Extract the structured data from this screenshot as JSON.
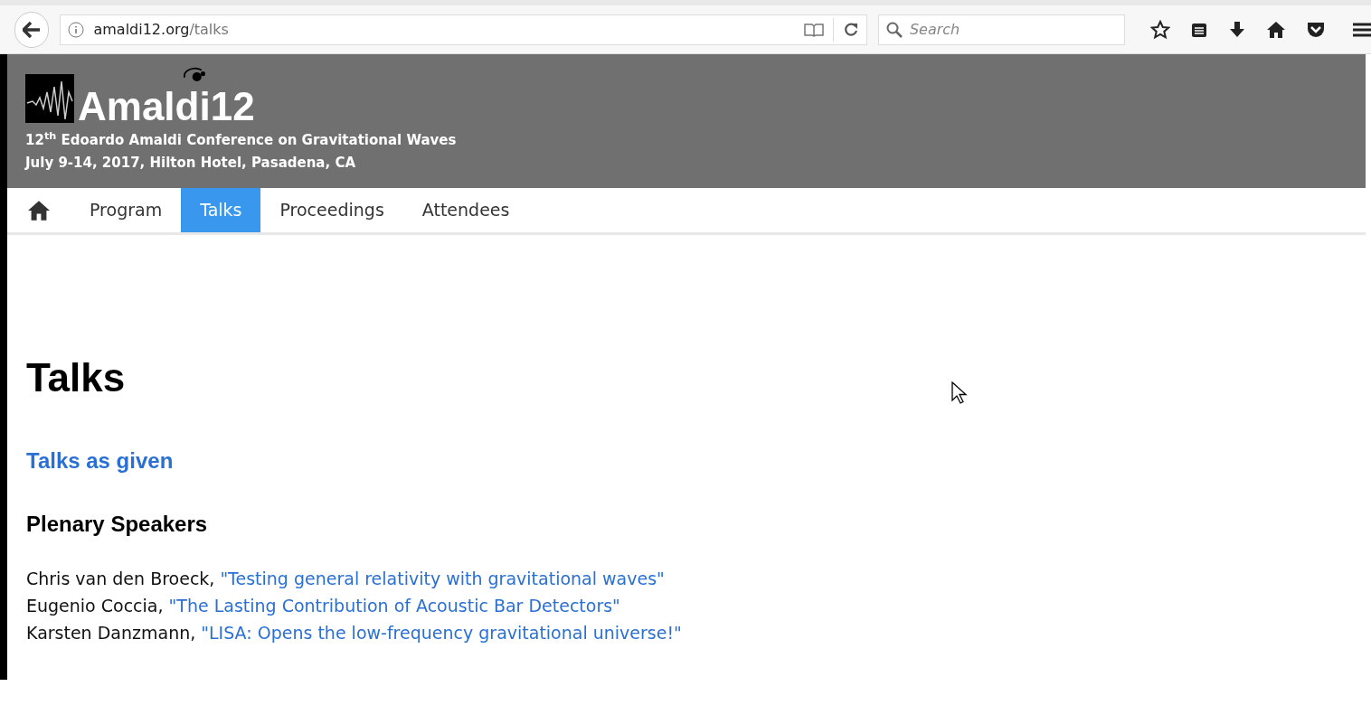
{
  "browser": {
    "url_host": "amaldi12.org",
    "url_path": "/talks",
    "search_placeholder": "Search"
  },
  "header": {
    "logo_text": "Amaldi12",
    "subtitle": "12$^{th}$ Edoardo Amaldi Conference on Gravitational Waves",
    "dates": "July 9-14, 2017, Hilton Hotel, Pasadena, CA"
  },
  "nav": [
    {
      "kind": "home",
      "selected": false
    },
    {
      "kind": "text",
      "label": "Program",
      "selected": false
    },
    {
      "kind": "text",
      "label": "Talks",
      "selected": true
    },
    {
      "kind": "text",
      "label": "Proceedings",
      "selected": false
    },
    {
      "kind": "text",
      "label": "Attendees",
      "selected": false
    }
  ],
  "page": {
    "heading": "Talks",
    "link": "Talks as given",
    "section": "Plenary Speakers",
    "talks": [
      {
        "speaker": "Chris van den Broeck,",
        "title": "\"Testing general relativity with gravitational waves\""
      },
      {
        "speaker": "Eugenio Coccia,",
        "title": "\"The Lasting Contribution of Acoustic Bar Detectors\""
      },
      {
        "speaker": "Karsten Danzmann,",
        "title": "\"LISA: Opens the low-frequency gravitational universe!\""
      }
    ]
  }
}
